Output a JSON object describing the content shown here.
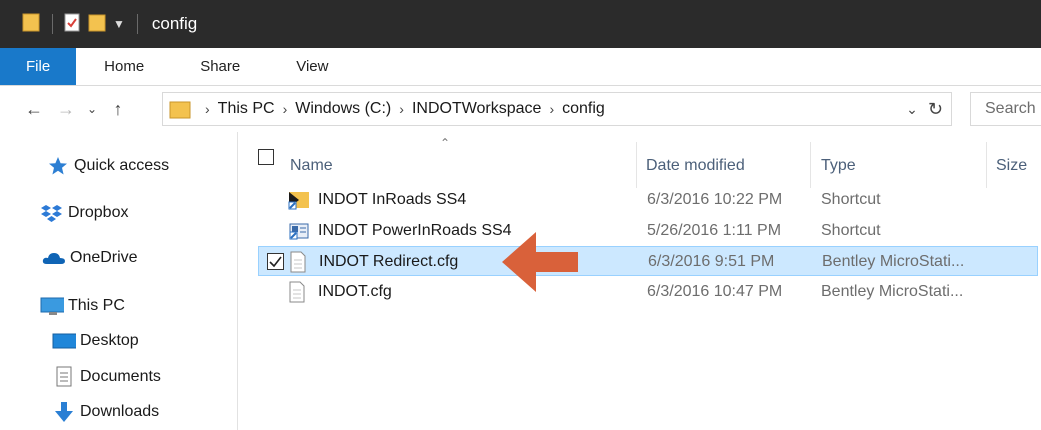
{
  "window": {
    "title": "config"
  },
  "ribbon": {
    "tabs": [
      "File",
      "Home",
      "Share",
      "View"
    ]
  },
  "address": {
    "crumbs": [
      "This PC",
      "Windows (C:)",
      "INDOTWorkspace",
      "config"
    ],
    "search_placeholder": "Search"
  },
  "navpane": {
    "items": [
      {
        "label": "Quick access",
        "icon": "star-icon"
      },
      {
        "label": "Dropbox",
        "icon": "dropbox-icon"
      },
      {
        "label": "OneDrive",
        "icon": "onedrive-icon"
      },
      {
        "label": "This PC",
        "icon": "computer-icon"
      },
      {
        "label": "Desktop",
        "icon": "desktop-icon"
      },
      {
        "label": "Documents",
        "icon": "documents-icon"
      },
      {
        "label": "Downloads",
        "icon": "downloads-icon"
      }
    ]
  },
  "columns": {
    "name": "Name",
    "date": "Date modified",
    "type": "Type",
    "size": "Size"
  },
  "files": [
    {
      "name": "INDOT InRoads SS4",
      "date": "6/3/2016 10:22 PM",
      "type": "Shortcut",
      "icon": "inroads-shortcut-icon",
      "selected": false
    },
    {
      "name": "INDOT PowerInRoads SS4",
      "date": "5/26/2016 1:11 PM",
      "type": "Shortcut",
      "icon": "powerinroads-shortcut-icon",
      "selected": false
    },
    {
      "name": "INDOT Redirect.cfg",
      "date": "6/3/2016 9:51 PM",
      "type": "Bentley MicroStati...",
      "icon": "file-icon",
      "selected": true
    },
    {
      "name": "INDOT.cfg",
      "date": "6/3/2016 10:47 PM",
      "type": "Bentley MicroStati...",
      "icon": "file-icon",
      "selected": false
    }
  ],
  "colors": {
    "file_tab": "#1979ca",
    "titlebar": "#2b2b2b",
    "selection": "#cce8ff",
    "arrow": "#d9613a"
  }
}
